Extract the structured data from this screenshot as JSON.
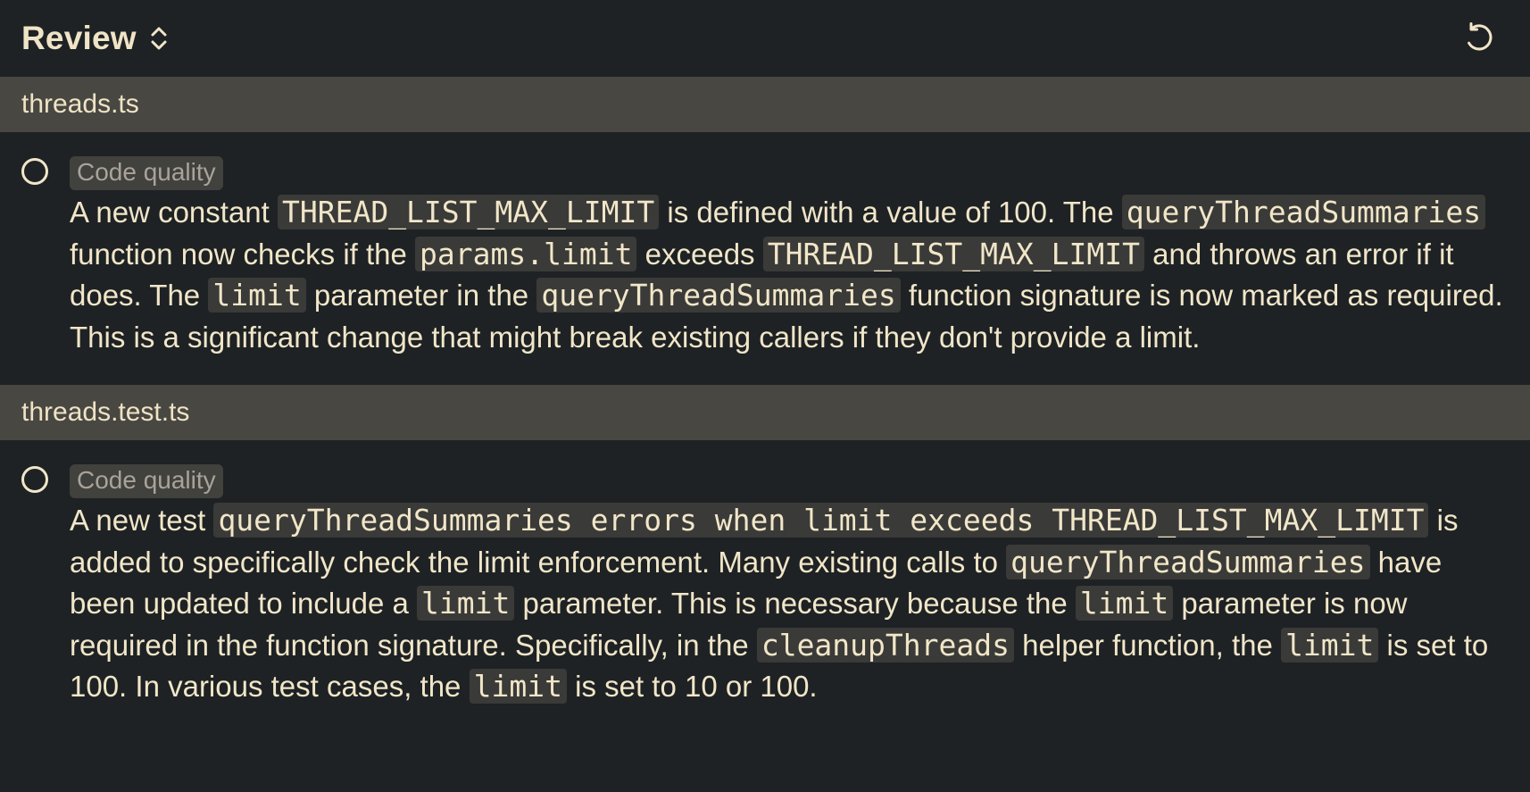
{
  "header": {
    "title": "Review",
    "sort_icon": "chevron-up-down-icon",
    "refresh_icon": "refresh-icon"
  },
  "files": [
    {
      "name": "threads.ts",
      "badge": "Code quality",
      "description": {
        "p1": "A new constant ",
        "c1": "THREAD_LIST_MAX_LIMIT",
        "p2": " is defined with a value of 100. The ",
        "c2": "queryThreadSummaries",
        "p3": " function now checks if the ",
        "c3": "params.limit",
        "p4": " exceeds ",
        "c4": "THREAD_LIST_MAX_LIMIT",
        "p5": " and throws an error if it does. The ",
        "c5": "limit",
        "p6": " parameter in the ",
        "c6": "queryThreadSummaries",
        "p7": " function signature is now marked as required. This is a significant change that might break existing callers if they don't provide a limit."
      }
    },
    {
      "name": "threads.test.ts",
      "badge": "Code quality",
      "description": {
        "p1": "A new test ",
        "c1": "queryThreadSummaries errors when limit exceeds THREAD_LIST_MAX_LIMIT",
        "p2": " is added to specifically check the limit enforcement. Many existing calls to ",
        "c2": "queryThreadSummaries",
        "p3": " have been updated to include a ",
        "c3": "limit",
        "p4": " parameter. This is necessary because the ",
        "c4": "limit",
        "p5": " parameter is now required in the function signature. Specifically, in the ",
        "c5": "cleanupThreads",
        "p6": " helper function, the ",
        "c6": "limit",
        "p7": " is set to 100. In various test cases, the ",
        "c7": "limit",
        "p8": " is set to 10 or 100."
      }
    }
  ],
  "colors": {
    "background": "#1e2225",
    "file_header_bg": "#484742",
    "text": "#f1e6c8",
    "badge_bg": "#41413d",
    "badge_text": "#a9a39a",
    "code_bg": "#3a3a38"
  }
}
